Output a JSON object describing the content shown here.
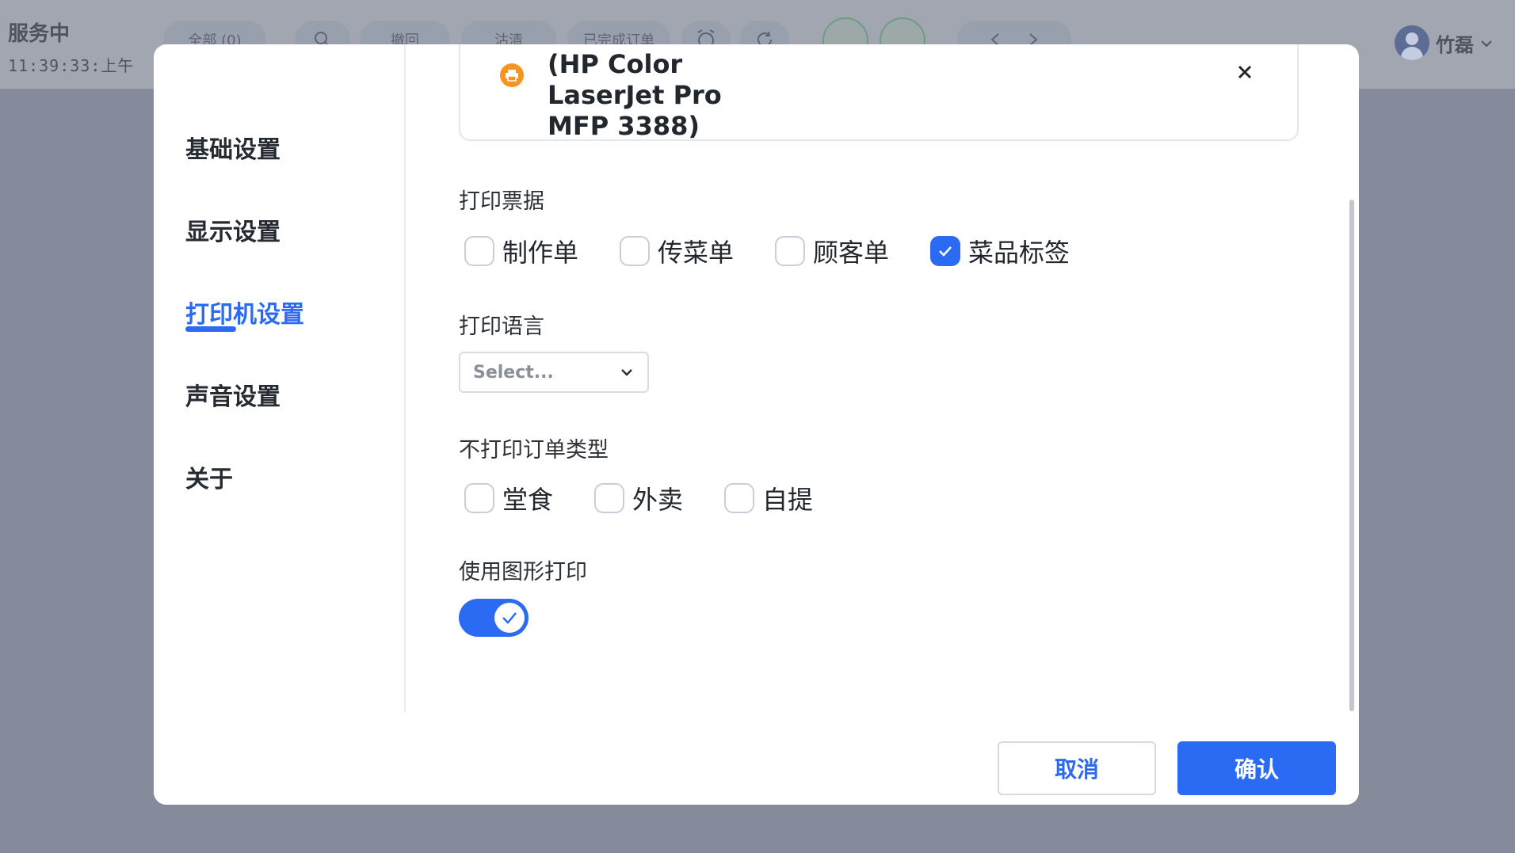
{
  "header": {
    "status_title": "服务中",
    "status_time": "11:39:33:上午",
    "pills": [
      "全部 (0)",
      "",
      "撤回",
      "沽清",
      "已完成订单"
    ],
    "user_name": "竹磊"
  },
  "modal": {
    "nav": [
      {
        "label": "基础设置",
        "active": false
      },
      {
        "label": "显示设置",
        "active": false
      },
      {
        "label": "打印机设置",
        "active": true
      },
      {
        "label": "声音设置",
        "active": false
      },
      {
        "label": "关于",
        "active": false
      }
    ],
    "printer": {
      "name_line1": "(HP Color",
      "name_line2": "LaserJet Pro",
      "name_line3": "MFP 3388)",
      "icon": "printer-icon",
      "icon_color": "#f7941d"
    },
    "receipts": {
      "label": "打印票据",
      "options": [
        {
          "label": "制作单",
          "checked": false
        },
        {
          "label": "传菜单",
          "checked": false
        },
        {
          "label": "顾客单",
          "checked": false
        },
        {
          "label": "菜品标签",
          "checked": true
        }
      ]
    },
    "language": {
      "label": "打印语言",
      "placeholder": "Select..."
    },
    "exclude_order_types": {
      "label": "不打印订单类型",
      "options": [
        {
          "label": "堂食",
          "checked": false
        },
        {
          "label": "外卖",
          "checked": false
        },
        {
          "label": "自提",
          "checked": false
        }
      ]
    },
    "graphic_print": {
      "label": "使用图形打印",
      "enabled": true
    },
    "footer": {
      "cancel_label": "取消",
      "confirm_label": "确认"
    }
  },
  "colors": {
    "accent": "#2b6bf4",
    "overlay": "#868b9c"
  }
}
